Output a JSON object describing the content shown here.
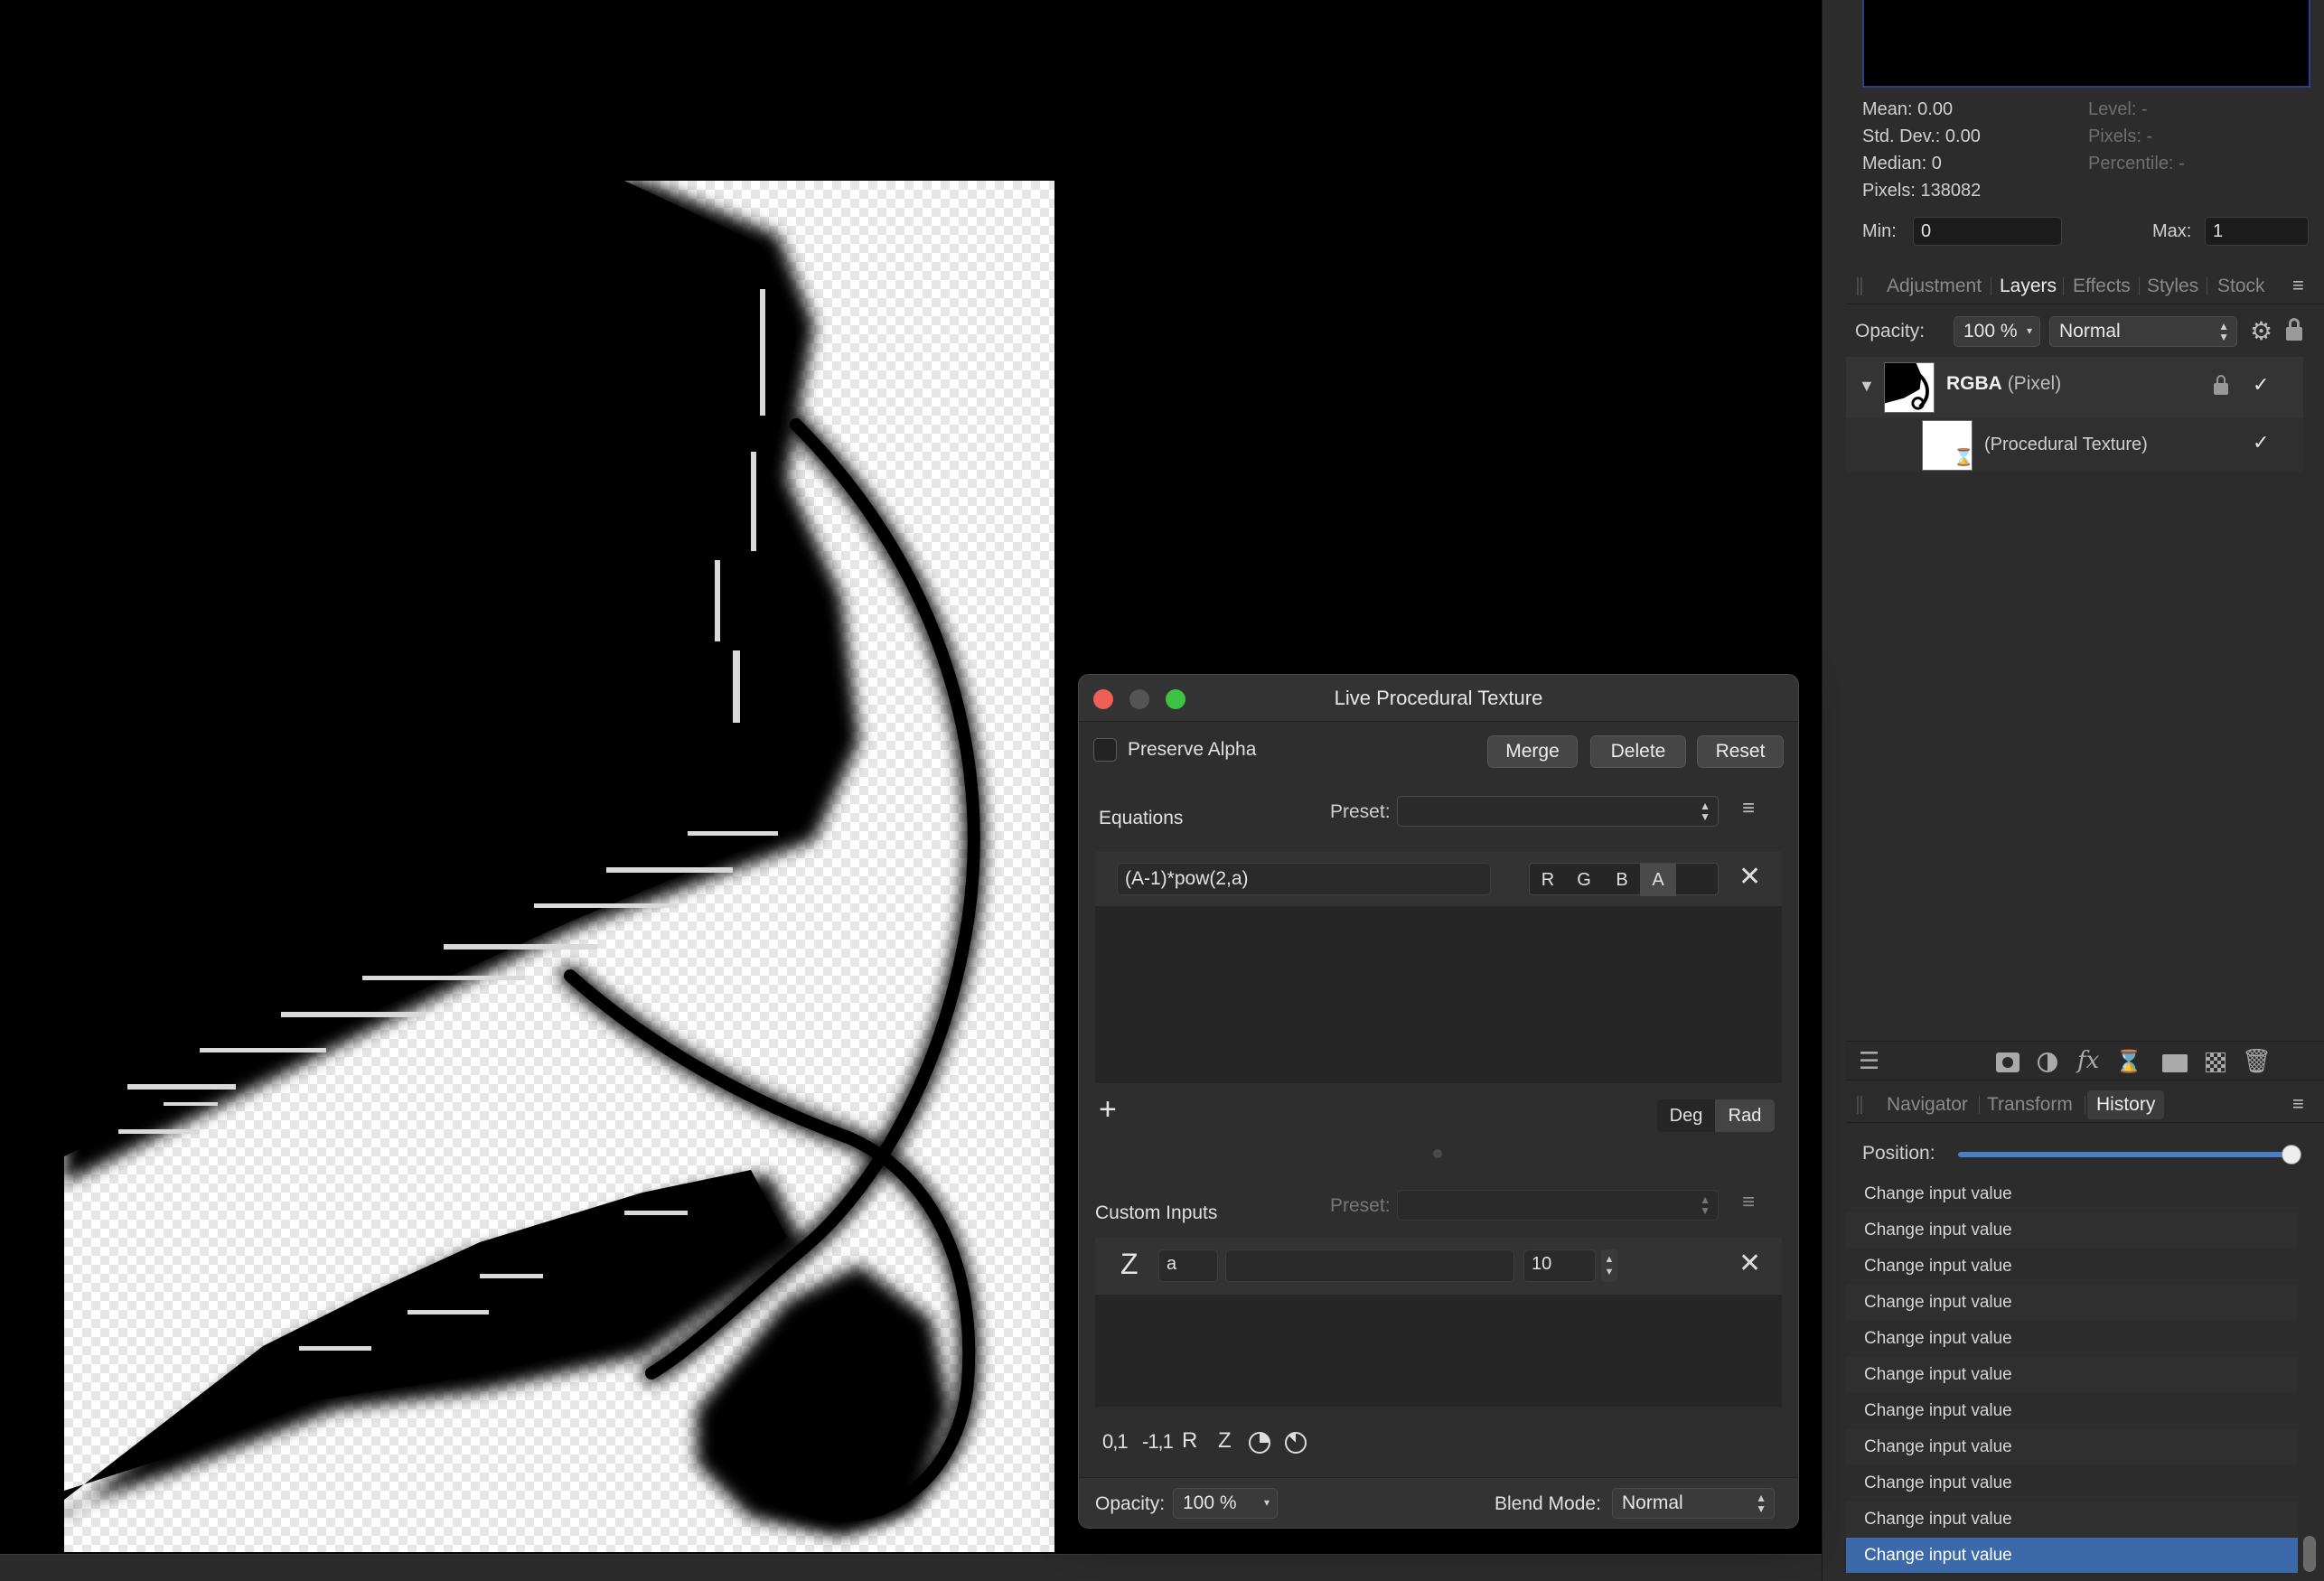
{
  "histogram": {
    "mean": "Mean: 0.00",
    "std_dev": "Std. Dev.: 0.00",
    "median": "Median: 0",
    "pixels": "Pixels: 138082",
    "level": "Level: -",
    "pixels_right": "Pixels: -",
    "percentile": "Percentile: -",
    "min_label": "Min:",
    "min_value": "0",
    "max_label": "Max:",
    "max_value": "1"
  },
  "studio_tabs": [
    "Adjustment",
    "Layers",
    "Effects",
    "Styles",
    "Stock"
  ],
  "layers": {
    "opacity_label": "Opacity:",
    "opacity_value": "100 %",
    "blend_mode": "Normal",
    "items": [
      {
        "name": "RGBA",
        "type": "(Pixel)"
      },
      {
        "name": "(Procedural Texture)"
      }
    ]
  },
  "history_tabs": [
    "Navigator",
    "Transform",
    "History"
  ],
  "history": {
    "position_label": "Position:",
    "position_fraction": 1.0,
    "items": [
      "Change input value",
      "Change input value",
      "Change input value",
      "Change input value",
      "Change input value",
      "Change input value",
      "Change input value",
      "Change input value",
      "Change input value",
      "Change input value",
      "Change input value"
    ]
  },
  "dialog": {
    "title": "Live Procedural Texture",
    "preserve_alpha": "Preserve Alpha",
    "merge": "Merge",
    "delete": "Delete",
    "reset": "Reset",
    "equations_label": "Equations",
    "preset_label": "Preset:",
    "equation": "(A-1)*pow(2,a)",
    "channels": [
      "R",
      "G",
      "B",
      "A"
    ],
    "add": "+",
    "deg": "Deg",
    "rad": "Rad",
    "custom_inputs_label": "Custom Inputs",
    "custom_preset_label": "Preset:",
    "input_icon": "Z",
    "input_name": "a",
    "input_value": "10",
    "bottom_tools": [
      "0,1",
      "-1,1",
      "R",
      "Z"
    ],
    "opacity_label": "Opacity:",
    "opacity_value": "100 %",
    "blend_label": "Blend Mode:",
    "blend_value": "Normal"
  },
  "colors": {
    "selection": "#3b69a9",
    "close": "#ed5f57",
    "zoom": "#3ec246"
  }
}
